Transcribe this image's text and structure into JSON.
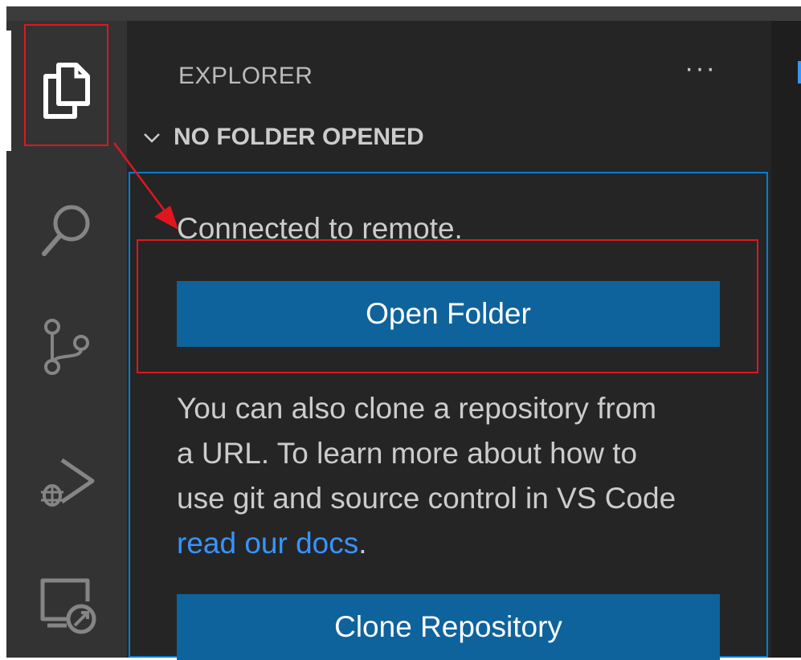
{
  "activity_bar": {
    "items": [
      {
        "name": "explorer",
        "icon": "files-icon",
        "active": true
      },
      {
        "name": "search",
        "icon": "search-icon",
        "active": false
      },
      {
        "name": "source-control",
        "icon": "source-control-icon",
        "active": false
      },
      {
        "name": "run-debug",
        "icon": "run-debug-icon",
        "active": false
      },
      {
        "name": "remote-explorer",
        "icon": "remote-explorer-icon",
        "active": false
      }
    ]
  },
  "sidebar": {
    "title": "EXPLORER",
    "more_actions": "···",
    "section": {
      "title": "NO FOLDER OPENED",
      "welcome_message": "Connected to remote.",
      "open_folder_label": "Open Folder",
      "help_lines": [
        "You can also clone a repository from",
        "a URL. To learn more about how to",
        "use git and source control in VS Code"
      ],
      "docs_link": "read our docs",
      "docs_suffix": ".",
      "clone_label": "Clone Repository"
    }
  },
  "colors": {
    "button": "#0e639c",
    "link": "#3794ff",
    "focus_border": "#007fd4",
    "annotation": "#e0161e"
  }
}
